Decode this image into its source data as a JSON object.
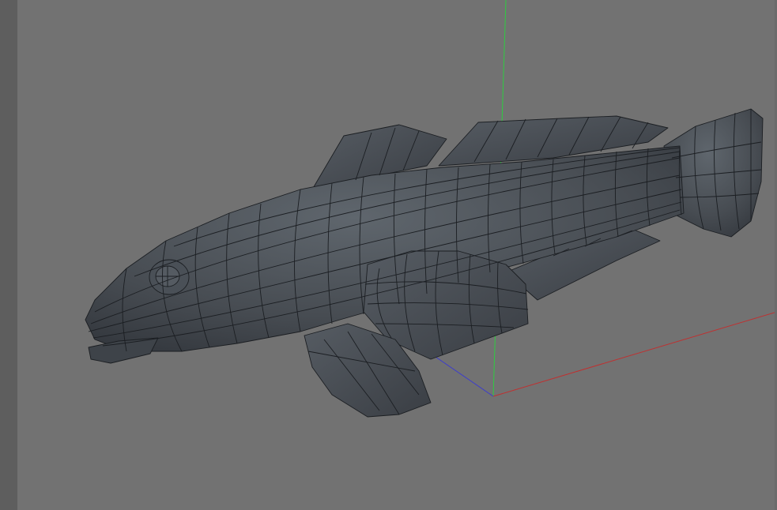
{
  "viewport": {
    "background": "#727272",
    "object_icon": "fish-mesh",
    "mesh_fill": "#474c52",
    "wire_color": "#1b1e22",
    "axes": {
      "x_color": "#c03030",
      "y_color": "#2ecc40",
      "z_color": "#3a3ad0"
    }
  }
}
